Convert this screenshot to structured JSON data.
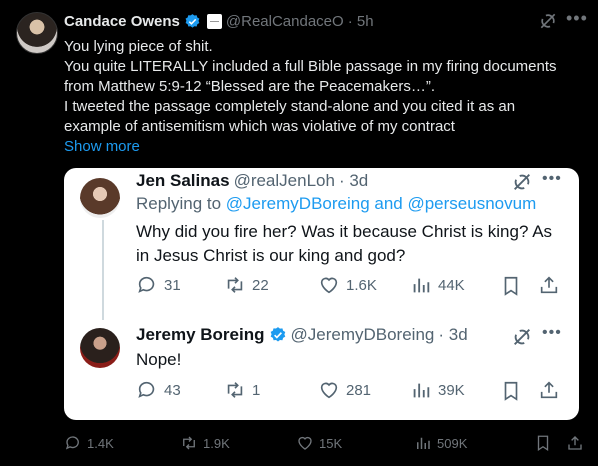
{
  "tweet": {
    "author_name": "Candace Owens",
    "handle": "@RealCandaceO",
    "time": "· 5h",
    "lines": [
      "You lying piece of shit.",
      "You quite LITERALLY included a full Bible passage in my firing documents",
      "from Matthew 5:9-12 “Blessed are the Peacemakers…”.",
      "I tweeted the passage completely stand-alone and you cited it as an",
      "example of antisemitism which was violative of my contract"
    ],
    "show_more": "Show more",
    "footer": {
      "replies": "1.4K",
      "reposts": "1.9K",
      "likes": "15K",
      "views": "509K"
    }
  },
  "quoted": {
    "reply1": {
      "name": "Jen Salinas",
      "handle": "@realJenLoh",
      "time": "· 3d",
      "replying_prefix": "Replying to",
      "replying_to": "@JeremyDBoreing and @perseusnovum",
      "line1": "Why did you fire her? Was it because Christ is king? As",
      "line2": "in Jesus Christ is our king and god?",
      "replies": "31",
      "reposts": "22",
      "likes": "1.6K",
      "views": "44K"
    },
    "reply2": {
      "name": "Jeremy Boreing",
      "handle": "@JeremyDBoreing",
      "time": "· 3d",
      "text": "Nope!",
      "replies": "43",
      "reposts": "1",
      "likes": "281",
      "views": "39K"
    }
  },
  "colors": {
    "accent": "#1d9bf0",
    "background": "#000000",
    "card": "#ffffff"
  }
}
